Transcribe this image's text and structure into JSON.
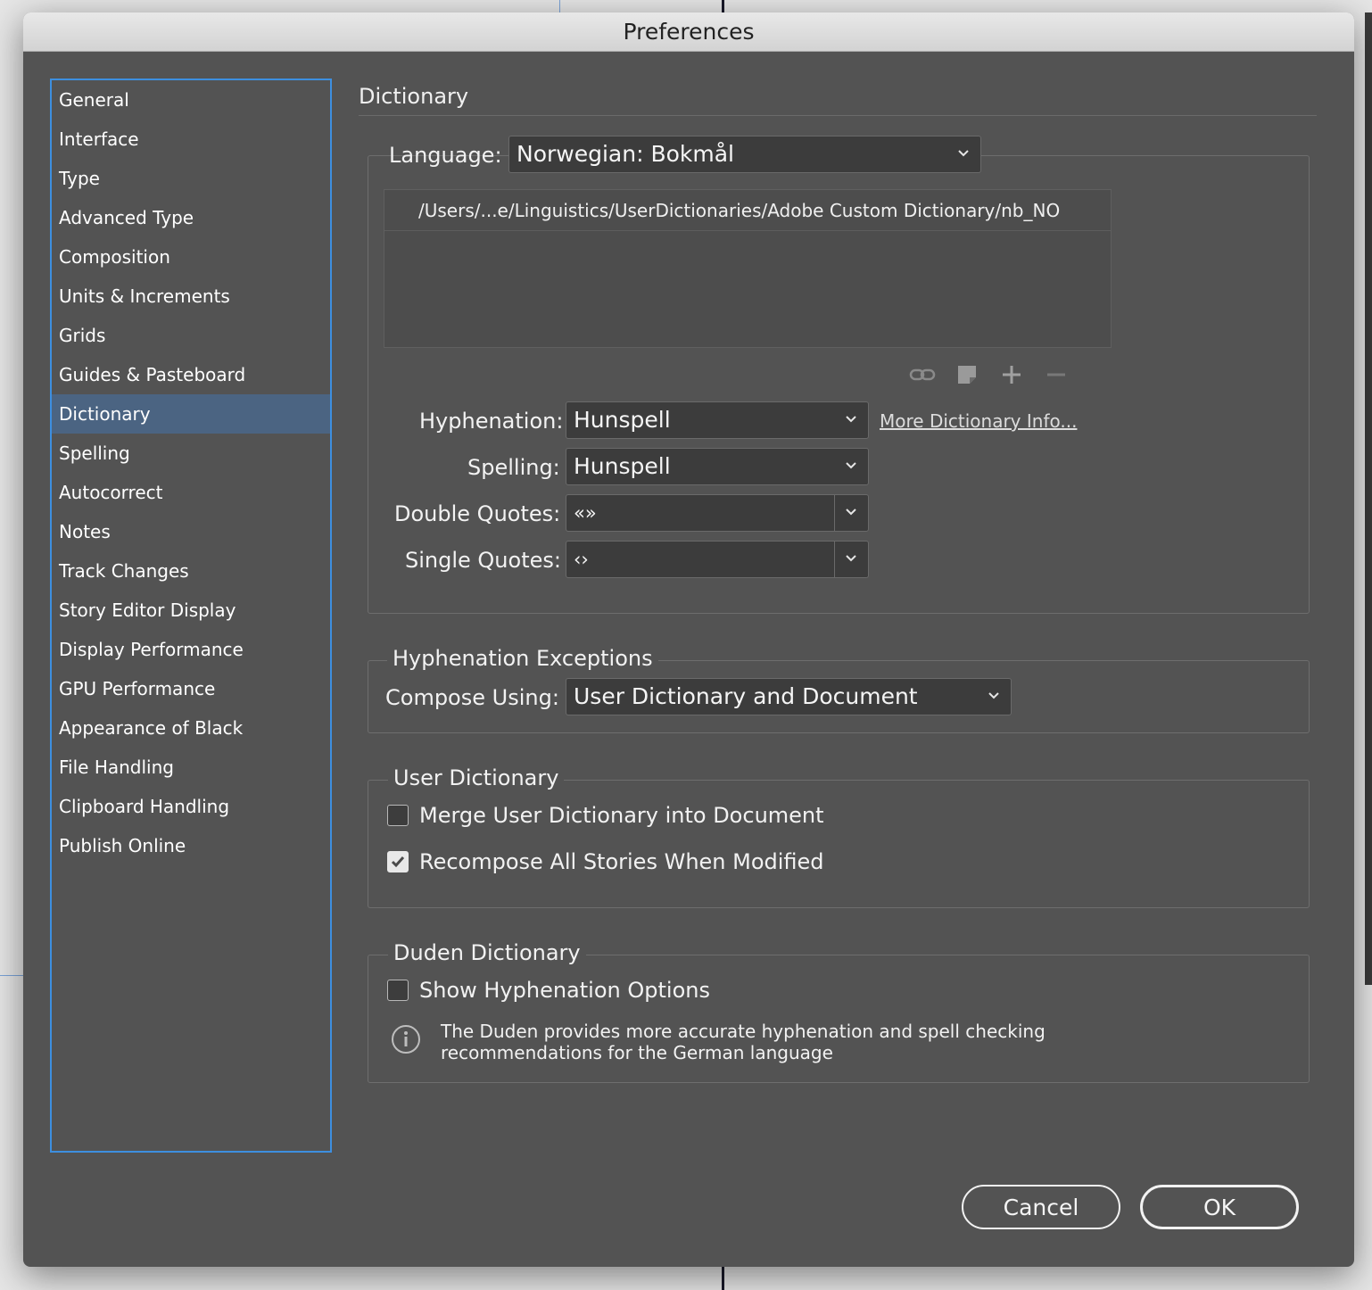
{
  "window": {
    "title": "Preferences"
  },
  "sidebar": {
    "items": [
      {
        "label": "General"
      },
      {
        "label": "Interface"
      },
      {
        "label": "Type"
      },
      {
        "label": "Advanced Type"
      },
      {
        "label": "Composition"
      },
      {
        "label": "Units & Increments"
      },
      {
        "label": "Grids"
      },
      {
        "label": "Guides & Pasteboard"
      },
      {
        "label": "Dictionary",
        "selected": true
      },
      {
        "label": "Spelling"
      },
      {
        "label": "Autocorrect"
      },
      {
        "label": "Notes"
      },
      {
        "label": "Track Changes"
      },
      {
        "label": "Story Editor Display"
      },
      {
        "label": "Display Performance"
      },
      {
        "label": "GPU Performance"
      },
      {
        "label": "Appearance of Black"
      },
      {
        "label": "File Handling"
      },
      {
        "label": "Clipboard Handling"
      },
      {
        "label": "Publish Online"
      }
    ]
  },
  "main": {
    "title": "Dictionary",
    "language": {
      "label": "Language:",
      "value": "Norwegian: Bokmål",
      "dictionaries": [
        "/Users/...e/Linguistics/UserDictionaries/Adobe Custom Dictionary/nb_NO"
      ],
      "icons": [
        "link-icon",
        "new-dictionary-icon",
        "plus-icon",
        "minus-icon"
      ]
    },
    "hyphenation": {
      "label": "Hyphenation:",
      "value": "Hunspell"
    },
    "more_info_link": "More Dictionary Info...",
    "spelling": {
      "label": "Spelling:",
      "value": "Hunspell"
    },
    "double_quotes": {
      "label": "Double Quotes:",
      "value": "«»"
    },
    "single_quotes": {
      "label": "Single Quotes:",
      "value": "‹›"
    },
    "hyphenation_exceptions": {
      "title": "Hyphenation Exceptions",
      "compose_label": "Compose Using:",
      "compose_value": "User Dictionary and Document"
    },
    "user_dictionary": {
      "title": "User Dictionary",
      "merge_label": "Merge User Dictionary into Document",
      "merge_checked": false,
      "recompose_label": "Recompose All Stories When Modified",
      "recompose_checked": true
    },
    "duden": {
      "title": "Duden Dictionary",
      "show_label": "Show Hyphenation Options",
      "show_checked": false,
      "info_line1": "The Duden provides more accurate hyphenation and spell checking",
      "info_line2": "recommendations for the German language"
    }
  },
  "buttons": {
    "cancel": "Cancel",
    "ok": "OK"
  },
  "colors": {
    "panel": "#535353",
    "selection": "#4b6482",
    "focus_ring": "#3d8fe0"
  }
}
